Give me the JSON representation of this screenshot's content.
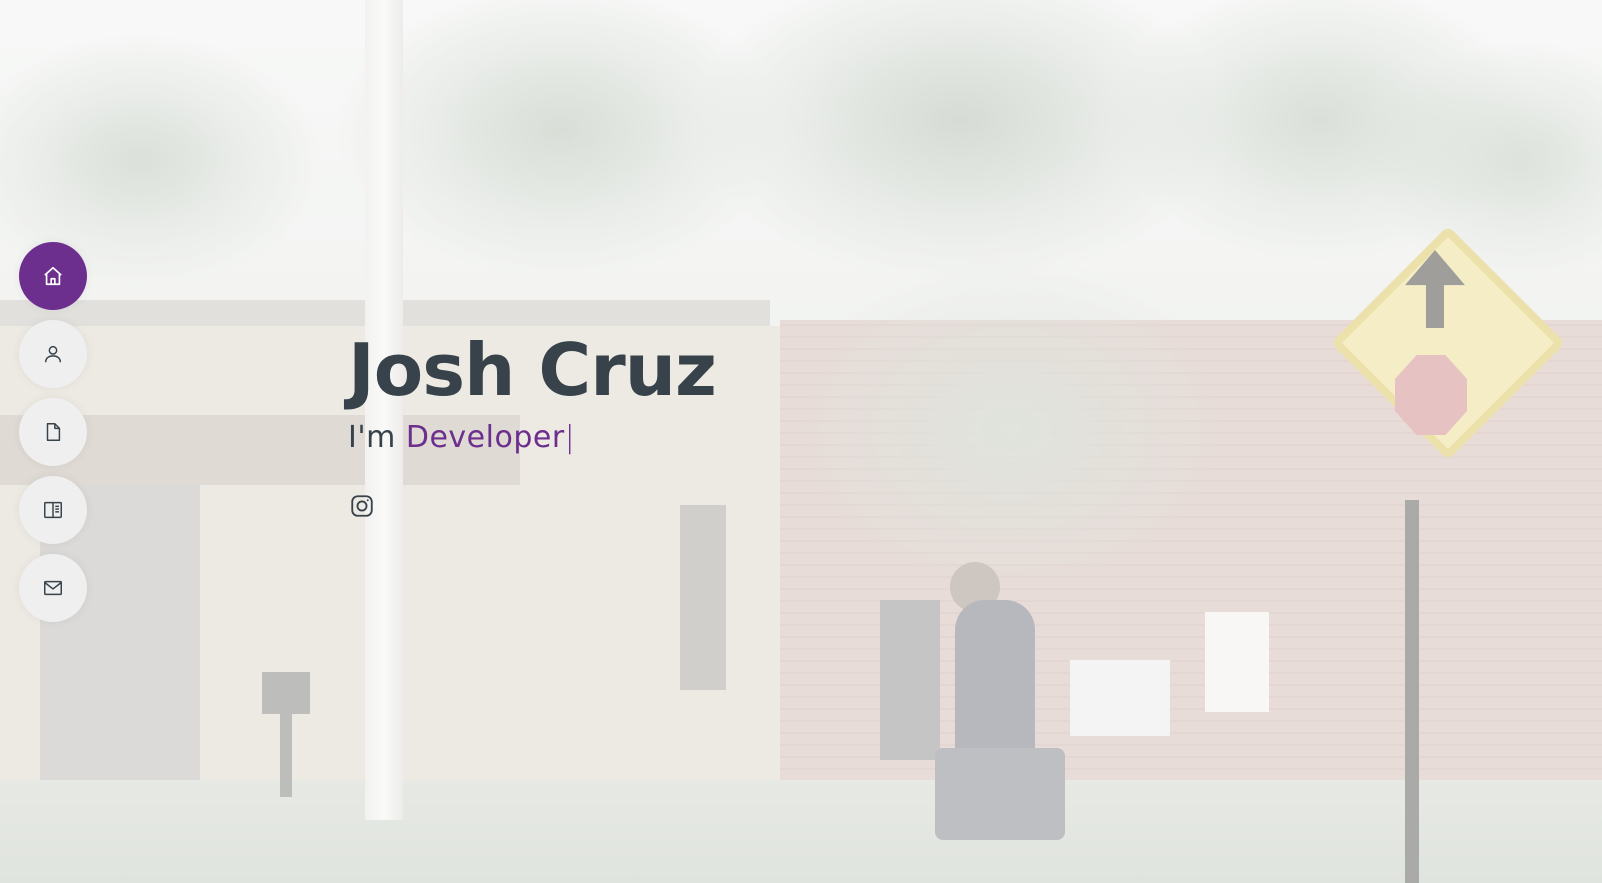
{
  "nav": {
    "items": [
      {
        "icon": "home-icon",
        "active": true
      },
      {
        "icon": "user-icon",
        "active": false
      },
      {
        "icon": "file-icon",
        "active": false
      },
      {
        "icon": "book-icon",
        "active": false
      },
      {
        "icon": "envelope-icon",
        "active": false
      }
    ]
  },
  "hero": {
    "name": "Josh Cruz",
    "tagline_prefix": "I'm ",
    "typed_text": "Developer",
    "cursor": "|"
  },
  "social": {
    "items": [
      {
        "icon": "instagram-icon"
      }
    ]
  },
  "colors": {
    "accent": "#6c2f8e",
    "heading": "#37424b",
    "nav_bg": "#efefef"
  }
}
